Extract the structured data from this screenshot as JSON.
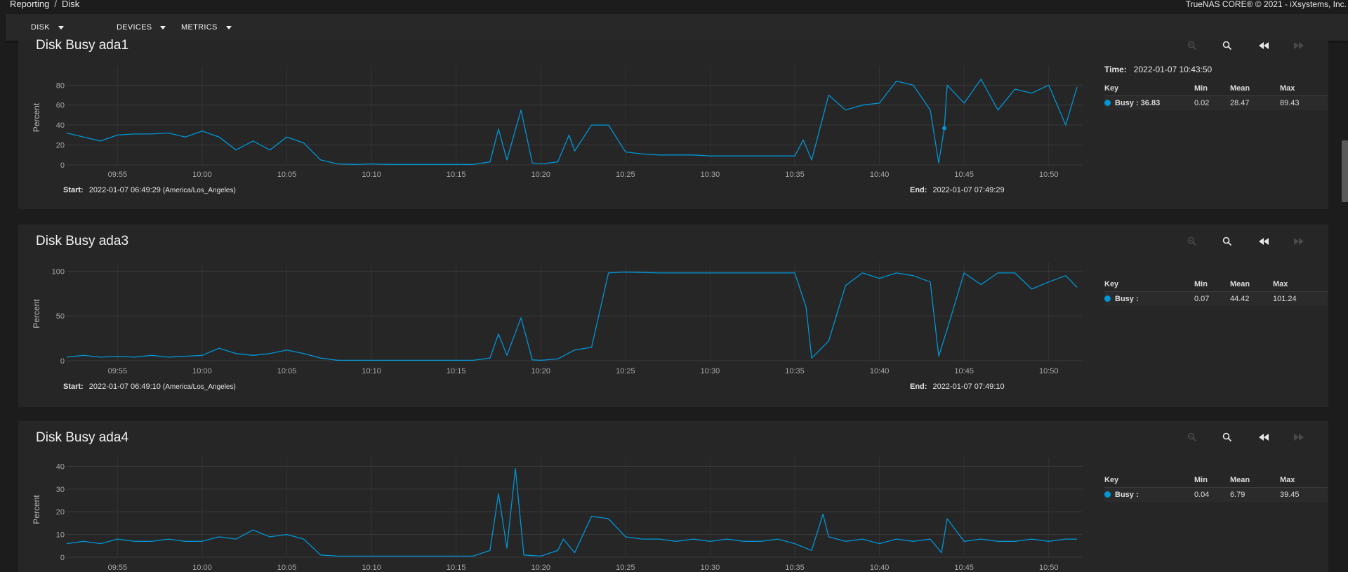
{
  "breadcrumb": {
    "parent": "Reporting",
    "separator": "/",
    "current": "Disk"
  },
  "copyright": "TrueNAS CORE® © 2021 - iXsystems, Inc.",
  "toolbar": {
    "disk": "DISK",
    "devices": "DEVICES",
    "metrics": "METRICS"
  },
  "accent_color": "#0095d5",
  "icons": [
    "zoom-out-icon",
    "zoom-in-icon",
    "step-back-icon",
    "step-forward-icon"
  ],
  "legend_headers": {
    "key": "Key",
    "min": "Min",
    "mean": "Mean",
    "max": "Max"
  },
  "meta_labels": {
    "start": "Start:",
    "end": "End:",
    "time": "Time:"
  },
  "cards": [
    {
      "title": "Disk Busy ada1",
      "ylabel": "Percent",
      "start": "2022-01-07 06:49:29",
      "end": "2022-01-07 07:49:29",
      "timezone": "(America/Los_Angeles)",
      "time": "2022-01-07 10:43:50",
      "legend": {
        "key": "Busy : 36.83",
        "min": "0.02",
        "mean": "28.47",
        "max": "89.43"
      }
    },
    {
      "title": "Disk Busy ada3",
      "ylabel": "Percent",
      "start": "2022-01-07 06:49:10",
      "end": "2022-01-07 07:49:10",
      "timezone": "(America/Los_Angeles)",
      "legend": {
        "key": "Busy :",
        "min": "0.07",
        "mean": "44.42",
        "max": "101.24"
      }
    },
    {
      "title": "Disk Busy ada4",
      "ylabel": "Percent",
      "legend": {
        "key": "Busy :",
        "min": "0.04",
        "mean": "6.79",
        "max": "39.45"
      }
    }
  ],
  "chart_data": [
    {
      "type": "line",
      "title": "Disk Busy ada1",
      "ylabel": "Percent",
      "x_ticks": [
        "09:55",
        "10:00",
        "10:05",
        "10:10",
        "10:15",
        "10:20",
        "10:25",
        "10:30",
        "10:35",
        "10:40",
        "10:45",
        "10:50"
      ],
      "x_range": [
        "09:52",
        "10:52"
      ],
      "y_ticks": [
        0,
        20,
        40,
        60,
        80
      ],
      "ylim": [
        0,
        95
      ],
      "grid": true,
      "highlight_point": {
        "x": "10:43:50",
        "y": 36.83
      },
      "series": [
        {
          "name": "Busy",
          "color": "#0095d5",
          "points": [
            [
              "09:52",
              32
            ],
            [
              "09:53",
              28
            ],
            [
              "09:54",
              24
            ],
            [
              "09:55",
              30
            ],
            [
              "09:56",
              31
            ],
            [
              "09:57",
              31
            ],
            [
              "09:58",
              32
            ],
            [
              "09:59",
              28
            ],
            [
              "10:00",
              34
            ],
            [
              "10:01",
              28
            ],
            [
              "10:02",
              15
            ],
            [
              "10:03",
              24
            ],
            [
              "10:04",
              15
            ],
            [
              "10:05",
              28
            ],
            [
              "10:06",
              22
            ],
            [
              "10:07",
              5
            ],
            [
              "10:08",
              1
            ],
            [
              "10:09",
              0.5
            ],
            [
              "10:10",
              1
            ],
            [
              "10:11",
              0.5
            ],
            [
              "10:12",
              0.5
            ],
            [
              "10:13",
              0.5
            ],
            [
              "10:14",
              0.5
            ],
            [
              "10:15",
              0.5
            ],
            [
              "10:16",
              0.5
            ],
            [
              "10:17",
              3
            ],
            [
              "10:17:30",
              36
            ],
            [
              "10:18",
              5
            ],
            [
              "10:18:50",
              55
            ],
            [
              "10:19:30",
              2
            ],
            [
              "10:20",
              1
            ],
            [
              "10:21",
              3
            ],
            [
              "10:21:40",
              30
            ],
            [
              "10:22",
              14
            ],
            [
              "10:23",
              40
            ],
            [
              "10:24",
              40
            ],
            [
              "10:25",
              13
            ],
            [
              "10:26",
              11
            ],
            [
              "10:27",
              10
            ],
            [
              "10:28",
              10
            ],
            [
              "10:29",
              10
            ],
            [
              "10:30",
              9
            ],
            [
              "10:31",
              9
            ],
            [
              "10:32",
              9
            ],
            [
              "10:33",
              9
            ],
            [
              "10:34",
              9
            ],
            [
              "10:35",
              9
            ],
            [
              "10:35:30",
              25
            ],
            [
              "10:36",
              5
            ],
            [
              "10:37",
              70
            ],
            [
              "10:38",
              55
            ],
            [
              "10:39",
              60
            ],
            [
              "10:40",
              62
            ],
            [
              "10:41",
              84
            ],
            [
              "10:42",
              80
            ],
            [
              "10:43",
              55
            ],
            [
              "10:43:30",
              2
            ],
            [
              "10:43:50",
              36.83
            ],
            [
              "10:44",
              80
            ],
            [
              "10:45",
              62
            ],
            [
              "10:46",
              86
            ],
            [
              "10:47",
              55
            ],
            [
              "10:48",
              76
            ],
            [
              "10:49",
              72
            ],
            [
              "10:50",
              80
            ],
            [
              "10:51",
              40
            ],
            [
              "10:51:40",
              78
            ]
          ]
        }
      ]
    },
    {
      "type": "line",
      "title": "Disk Busy ada3",
      "ylabel": "Percent",
      "x_ticks": [
        "09:55",
        "10:00",
        "10:05",
        "10:10",
        "10:15",
        "10:20",
        "10:25",
        "10:30",
        "10:35",
        "10:40",
        "10:45",
        "10:50"
      ],
      "x_range": [
        "09:52",
        "10:52"
      ],
      "y_ticks": [
        0,
        50,
        100
      ],
      "ylim": [
        0,
        105
      ],
      "grid": true,
      "series": [
        {
          "name": "Busy",
          "color": "#0095d5",
          "points": [
            [
              "09:52",
              4
            ],
            [
              "09:53",
              6
            ],
            [
              "09:54",
              4
            ],
            [
              "09:55",
              5
            ],
            [
              "09:56",
              4
            ],
            [
              "09:57",
              6
            ],
            [
              "09:58",
              4
            ],
            [
              "09:59",
              5
            ],
            [
              "10:00",
              6
            ],
            [
              "10:01",
              14
            ],
            [
              "10:02",
              8
            ],
            [
              "10:03",
              6
            ],
            [
              "10:04",
              8
            ],
            [
              "10:05",
              12
            ],
            [
              "10:06",
              8
            ],
            [
              "10:07",
              3
            ],
            [
              "10:08",
              0.5
            ],
            [
              "10:10",
              0.5
            ],
            [
              "10:12",
              0.5
            ],
            [
              "10:14",
              0.5
            ],
            [
              "10:16",
              0.5
            ],
            [
              "10:17",
              3
            ],
            [
              "10:17:30",
              30
            ],
            [
              "10:18",
              6
            ],
            [
              "10:18:50",
              48
            ],
            [
              "10:19:30",
              1
            ],
            [
              "10:20",
              0.5
            ],
            [
              "10:21",
              2
            ],
            [
              "10:22",
              12
            ],
            [
              "10:23",
              15
            ],
            [
              "10:24",
              98
            ],
            [
              "10:25",
              99
            ],
            [
              "10:27",
              98
            ],
            [
              "10:29",
              98
            ],
            [
              "10:31",
              98
            ],
            [
              "10:33",
              98
            ],
            [
              "10:35",
              98
            ],
            [
              "10:35:40",
              60
            ],
            [
              "10:36",
              3
            ],
            [
              "10:37",
              22
            ],
            [
              "10:38",
              84
            ],
            [
              "10:39",
              98
            ],
            [
              "10:40",
              92
            ],
            [
              "10:41",
              98
            ],
            [
              "10:42",
              95
            ],
            [
              "10:43",
              88
            ],
            [
              "10:43:30",
              5
            ],
            [
              "10:44",
              35
            ],
            [
              "10:45",
              98
            ],
            [
              "10:46",
              85
            ],
            [
              "10:47",
              98
            ],
            [
              "10:48",
              98
            ],
            [
              "10:49",
              80
            ],
            [
              "10:50",
              88
            ],
            [
              "10:51",
              95
            ],
            [
              "10:51:40",
              82
            ]
          ]
        }
      ]
    },
    {
      "type": "line",
      "title": "Disk Busy ada4",
      "ylabel": "Percent",
      "x_ticks": [
        "09:55",
        "10:00",
        "10:05",
        "10:10",
        "10:15",
        "10:20",
        "10:25",
        "10:30",
        "10:35",
        "10:40",
        "10:45",
        "10:50"
      ],
      "x_range": [
        "09:52",
        "10:52"
      ],
      "y_ticks": [
        0,
        10,
        20,
        30,
        40
      ],
      "ylim": [
        0,
        42
      ],
      "grid": true,
      "series": [
        {
          "name": "Busy",
          "color": "#0095d5",
          "points": [
            [
              "09:52",
              6
            ],
            [
              "09:53",
              7
            ],
            [
              "09:54",
              6
            ],
            [
              "09:55",
              8
            ],
            [
              "09:56",
              7
            ],
            [
              "09:57",
              7
            ],
            [
              "09:58",
              8
            ],
            [
              "09:59",
              7
            ],
            [
              "10:00",
              7
            ],
            [
              "10:01",
              9
            ],
            [
              "10:02",
              8
            ],
            [
              "10:03",
              12
            ],
            [
              "10:04",
              9
            ],
            [
              "10:05",
              10
            ],
            [
              "10:06",
              8
            ],
            [
              "10:07",
              1
            ],
            [
              "10:08",
              0.5
            ],
            [
              "10:10",
              0.5
            ],
            [
              "10:12",
              0.5
            ],
            [
              "10:14",
              0.5
            ],
            [
              "10:16",
              0.5
            ],
            [
              "10:17",
              3
            ],
            [
              "10:17:30",
              28
            ],
            [
              "10:18",
              4
            ],
            [
              "10:18:30",
              39
            ],
            [
              "10:19",
              1
            ],
            [
              "10:20",
              0.5
            ],
            [
              "10:21",
              3
            ],
            [
              "10:21:20",
              8
            ],
            [
              "10:22",
              2
            ],
            [
              "10:23",
              18
            ],
            [
              "10:24",
              17
            ],
            [
              "10:25",
              9
            ],
            [
              "10:26",
              8
            ],
            [
              "10:27",
              8
            ],
            [
              "10:28",
              7
            ],
            [
              "10:29",
              8
            ],
            [
              "10:30",
              7
            ],
            [
              "10:31",
              8
            ],
            [
              "10:32",
              7
            ],
            [
              "10:33",
              7
            ],
            [
              "10:34",
              8
            ],
            [
              "10:35",
              6
            ],
            [
              "10:36",
              3
            ],
            [
              "10:36:40",
              19
            ],
            [
              "10:37",
              9
            ],
            [
              "10:38",
              7
            ],
            [
              "10:39",
              8
            ],
            [
              "10:40",
              6
            ],
            [
              "10:41",
              8
            ],
            [
              "10:42",
              7
            ],
            [
              "10:43",
              8
            ],
            [
              "10:43:40",
              2
            ],
            [
              "10:44",
              17
            ],
            [
              "10:45",
              7
            ],
            [
              "10:46",
              8
            ],
            [
              "10:47",
              7
            ],
            [
              "10:48",
              7
            ],
            [
              "10:49",
              8
            ],
            [
              "10:50",
              7
            ],
            [
              "10:51",
              8
            ],
            [
              "10:51:40",
              8
            ]
          ]
        }
      ]
    }
  ]
}
